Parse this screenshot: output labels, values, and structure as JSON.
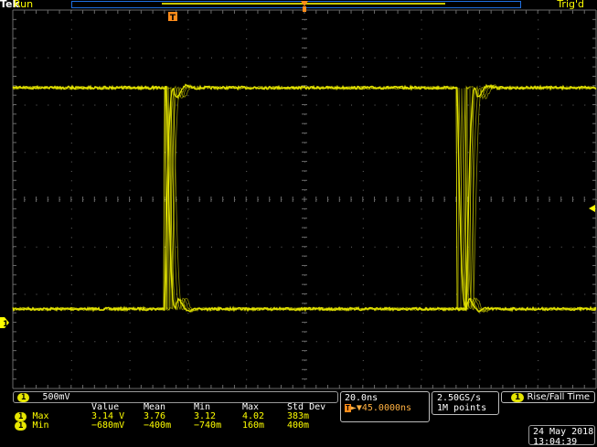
{
  "header": {
    "brand": "Tek",
    "run_state": "Run",
    "trigger_state": "Trig'd",
    "trigger_marker": "T"
  },
  "channel": {
    "number": "1",
    "scale": "500mV"
  },
  "measurements": {
    "columns": [
      "Value",
      "Mean",
      "Min",
      "Max",
      "Std Dev"
    ],
    "rows": [
      {
        "label": "Max",
        "values": [
          "3.14 V",
          "3.76",
          "3.12",
          "4.02",
          "383m"
        ]
      },
      {
        "label": "Min",
        "values": [
          "−680mV",
          "−400m",
          "−740m",
          "160m",
          "400m"
        ]
      }
    ]
  },
  "timebase": {
    "scale": "20.0ns",
    "delay": "45.0000ns"
  },
  "acquisition": {
    "sample_rate": "2.50GS/s",
    "record_length": "1M points"
  },
  "measurement_type": "Rise/Fall Time",
  "datetime": {
    "date": "24 May 2018",
    "time": "13:04:39"
  },
  "colors": {
    "trace": "#e8e800",
    "grid": "#6a6a6a",
    "background": "#000000",
    "accent_blue": "#1e6fe0"
  }
}
